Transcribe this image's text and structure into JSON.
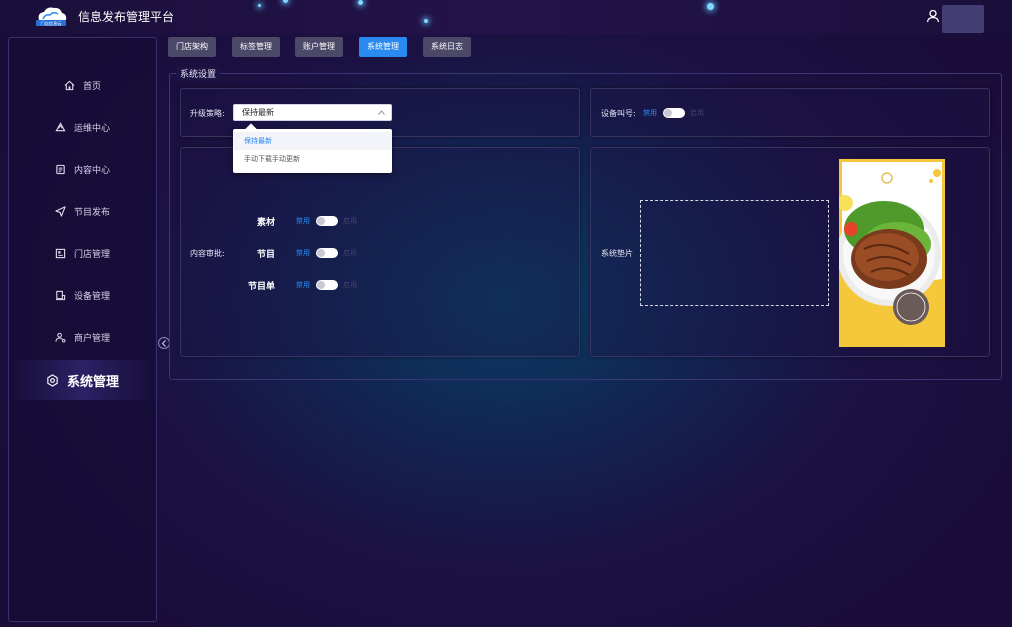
{
  "header": {
    "logo_text": "门店信息云",
    "title": "信息发布管理平台",
    "user_icon": "user-icon"
  },
  "sidebar": {
    "items": [
      {
        "label": "首页",
        "icon": "home-icon"
      },
      {
        "label": "运维中心",
        "icon": "recycle-icon"
      },
      {
        "label": "内容中心",
        "icon": "document-icon"
      },
      {
        "label": "节目发布",
        "icon": "send-icon"
      },
      {
        "label": "门店管理",
        "icon": "store-icon"
      },
      {
        "label": "设备管理",
        "icon": "device-icon"
      },
      {
        "label": "商户管理",
        "icon": "merchant-icon"
      },
      {
        "label": "系统管理",
        "icon": "settings-icon"
      }
    ],
    "active": "系统管理"
  },
  "tabs": [
    {
      "label": "门店架构"
    },
    {
      "label": "标签管理"
    },
    {
      "label": "账户管理"
    },
    {
      "label": "系统管理",
      "active": true
    },
    {
      "label": "系统日志"
    }
  ],
  "settings": {
    "title": "系统设置",
    "upgrade": {
      "label": "升级策略:",
      "value": "保持最新",
      "options": [
        "保持最新",
        "手动下载手动更新"
      ]
    },
    "device_call": {
      "label": "设备叫号:",
      "off": "禁用",
      "on": "启用"
    },
    "audit": {
      "label": "内容审批:",
      "items": [
        {
          "name": "素材",
          "off": "禁用",
          "on": "启用"
        },
        {
          "name": "节目",
          "off": "禁用",
          "on": "启用"
        },
        {
          "name": "节目单",
          "off": "禁用",
          "on": "启用"
        }
      ]
    },
    "pad": {
      "label": "系统垫片"
    }
  },
  "colors": {
    "accent": "#2a8af0",
    "tab_bg": "#4b4868",
    "background": "#1a0d3a"
  }
}
